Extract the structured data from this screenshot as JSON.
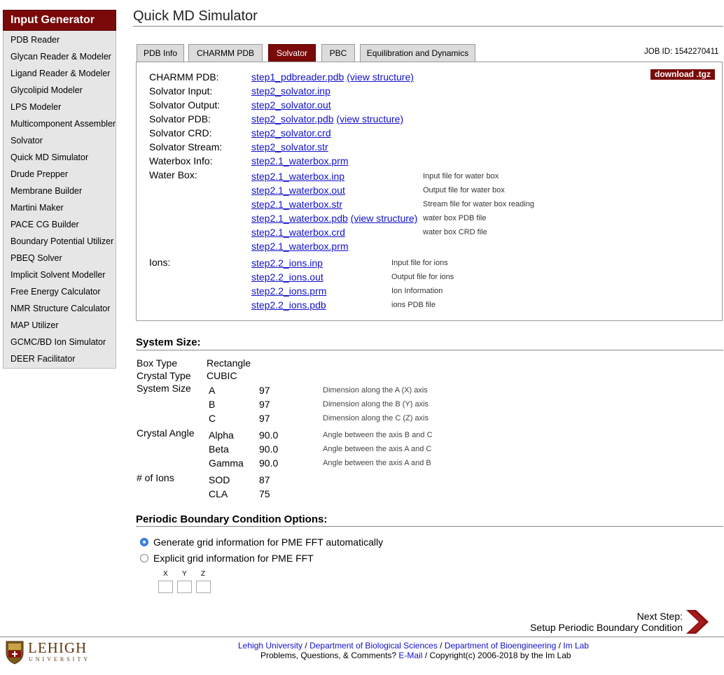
{
  "sidebar": {
    "title": "Input Generator",
    "items": [
      "PDB Reader",
      "Glycan Reader & Modeler",
      "Ligand Reader & Modeler",
      "Glycolipid Modeler",
      "LPS Modeler",
      "Multicomponent Assembler",
      "Solvator",
      "Quick MD Simulator",
      "Drude Prepper",
      "Membrane Builder",
      "Martini Maker",
      "PACE CG Builder",
      "Boundary Potential Utilizer",
      "PBEQ Solver",
      "Implicit Solvent Modeller",
      "Free Energy Calculator",
      "NMR Structure Calculator",
      "MAP Utilizer",
      "GCMC/BD Ion Simulator",
      "DEER Facilitator"
    ]
  },
  "page_title": "Quick MD Simulator",
  "tabs": [
    {
      "label": "PDB Info",
      "active": false
    },
    {
      "label": "CHARMM PDB",
      "active": false
    },
    {
      "label": "Solvator",
      "active": true
    },
    {
      "label": "PBC",
      "active": false
    },
    {
      "label": "Equilibration and Dynamics",
      "active": false
    }
  ],
  "job_id": "JOB ID: 1542270411",
  "download_label": "download .tgz",
  "files": {
    "charmm_pdb": {
      "label": "CHARMM PDB:",
      "file": "step1_pdbreader.pdb",
      "view": "(view structure)"
    },
    "solvator_input": {
      "label": "Solvator Input:",
      "file": "step2_solvator.inp"
    },
    "solvator_output": {
      "label": "Solvator Output:",
      "file": "step2_solvator.out"
    },
    "solvator_pdb": {
      "label": "Solvator PDB:",
      "file": "step2_solvator.pdb",
      "view": "(view structure)"
    },
    "solvator_crd": {
      "label": "Solvator CRD:",
      "file": "step2_solvator.crd"
    },
    "solvator_stream": {
      "label": "Solvator Stream:",
      "file": "step2_solvator.str"
    },
    "waterbox_info": {
      "label": "Waterbox Info:",
      "file": "step2.1_waterbox.prm"
    },
    "water_box": {
      "label": "Water Box:",
      "rows": [
        {
          "file": "step2.1_waterbox.inp",
          "note": "Input file for water box"
        },
        {
          "file": "step2.1_waterbox.out",
          "note": "Output file for water box"
        },
        {
          "file": "step2.1_waterbox.str",
          "note": "Stream file for water box reading"
        },
        {
          "file": "step2.1_waterbox.pdb",
          "view": "(view structure)",
          "note": "water box PDB file"
        },
        {
          "file": "step2.1_waterbox.crd",
          "note": "water box CRD file"
        },
        {
          "file": "step2.1_waterbox.prm",
          "note": ""
        }
      ]
    },
    "ions": {
      "label": "Ions:",
      "rows": [
        {
          "file": "step2.2_ions.inp",
          "note": "Input file for ions"
        },
        {
          "file": "step2.2_ions.out",
          "note": "Output file for ions"
        },
        {
          "file": "step2.2_ions.prm",
          "note": "Ion Information"
        },
        {
          "file": "step2.2_ions.pdb",
          "note": "ions PDB file"
        }
      ]
    }
  },
  "system_size": {
    "heading": "System Size:",
    "box_type_label": "Box Type",
    "box_type": "Rectangle",
    "crystal_type_label": "Crystal Type",
    "crystal_type": "CUBIC",
    "size_label": "System Size",
    "dims": [
      {
        "name": "A",
        "value": "97",
        "note": "Dimension along the A (X) axis"
      },
      {
        "name": "B",
        "value": "97",
        "note": "Dimension along the B (Y) axis"
      },
      {
        "name": "C",
        "value": "97",
        "note": "Dimension along the C (Z) axis"
      }
    ],
    "angle_label": "Crystal Angle",
    "angles": [
      {
        "name": "Alpha",
        "value": "90.0",
        "note": "Angle between the axis B and C"
      },
      {
        "name": "Beta",
        "value": "90.0",
        "note": "Angle between the axis A and C"
      },
      {
        "name": "Gamma",
        "value": "90.0",
        "note": "Angle between the axis A and B"
      }
    ],
    "ions_label": "# of Ions",
    "ions": [
      {
        "name": "SOD",
        "value": "87"
      },
      {
        "name": "CLA",
        "value": "75"
      }
    ]
  },
  "pbc": {
    "heading": "Periodic Boundary Condition Options:",
    "option_auto": "Generate grid information for PME FFT automatically",
    "option_explicit": "Explicit grid information for PME FFT",
    "auto_selected": true,
    "x_label": "X",
    "y_label": "Y",
    "z_label": "Z",
    "x_value": "",
    "y_value": "",
    "z_value": ""
  },
  "next_step": {
    "line1": "Next Step:",
    "line2": "Setup Periodic Boundary Condition"
  },
  "footer": {
    "links": [
      "Lehigh University",
      "Department of Biological Sciences",
      "Department of Bioengineering",
      "Im Lab"
    ],
    "line2_prefix": "Problems, Questions, & Comments?",
    "email": "E-Mail",
    "copyright": "/ Copyright(c) 2006-2018 by the Im Lab",
    "logo_text": "LEHIGH",
    "logo_sub": "UNIVERSITY"
  },
  "colors": {
    "accent": "#7a0a0a",
    "link": "#1111cc",
    "radio": "#3a86e8"
  }
}
